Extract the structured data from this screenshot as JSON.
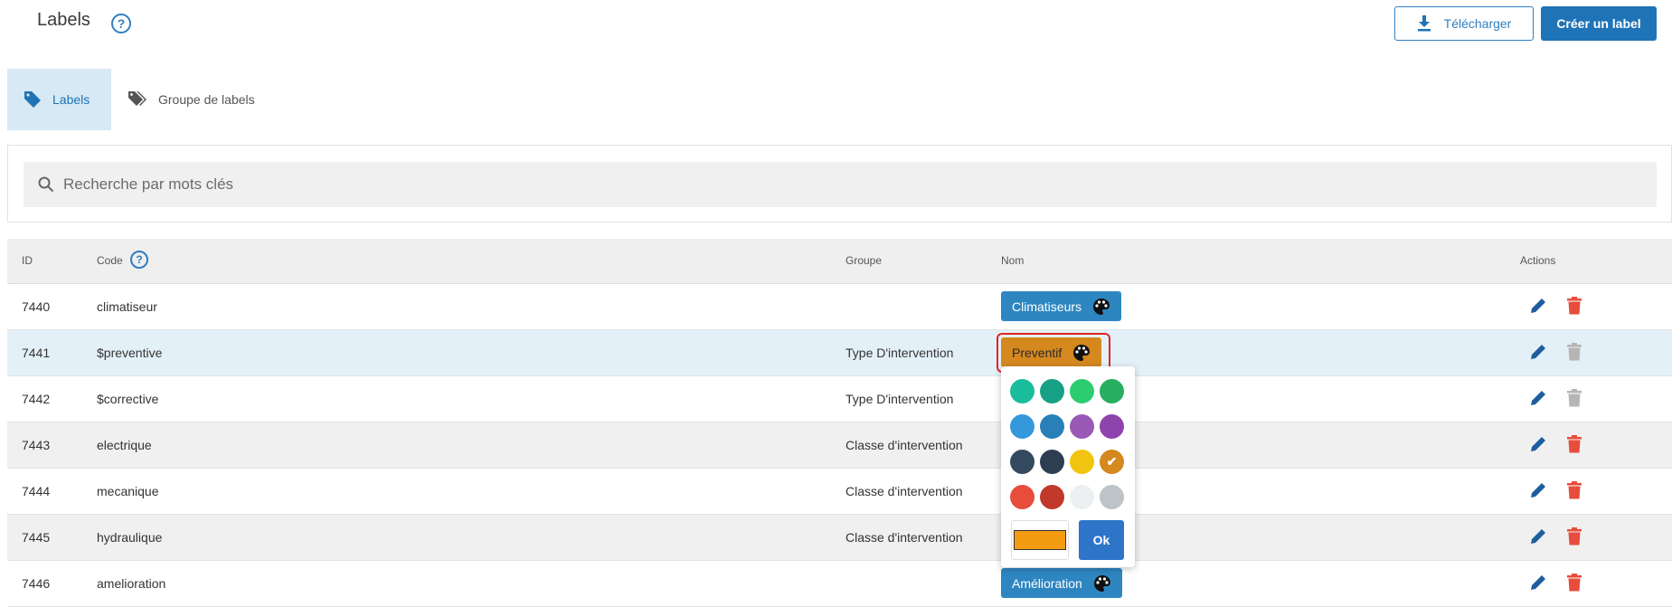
{
  "header": {
    "title": "Labels",
    "help_glyph": "?",
    "download_label": "Télécharger",
    "create_label": "Créer un label"
  },
  "tabs": [
    {
      "label": "Labels",
      "active": true,
      "icon": "tag-icon"
    },
    {
      "label": "Groupe de labels",
      "active": false,
      "icon": "tags-icon"
    }
  ],
  "search": {
    "placeholder": "Recherche par mots clés",
    "value": ""
  },
  "table": {
    "headers": {
      "id": "ID",
      "code": "Code",
      "groupe": "Groupe",
      "nom": "Nom",
      "actions": "Actions"
    },
    "rows": [
      {
        "id": "7440",
        "code": "climatiseur",
        "groupe": "",
        "nom": "Climatiseurs",
        "badge_color": "#2e86c1"
      },
      {
        "id": "7441",
        "code": "$preventive",
        "groupe": "Type D'intervention",
        "nom": "Preventif",
        "badge_color": "#d4881e"
      },
      {
        "id": "7442",
        "code": "$corrective",
        "groupe": "Type D'intervention",
        "nom": "",
        "badge_color": ""
      },
      {
        "id": "7443",
        "code": "electrique",
        "groupe": "Classe d'intervention",
        "nom": "",
        "badge_color": ""
      },
      {
        "id": "7444",
        "code": "mecanique",
        "groupe": "Classe d'intervention",
        "nom": "",
        "badge_color": ""
      },
      {
        "id": "7445",
        "code": "hydraulique",
        "groupe": "Classe d'intervention",
        "nom": "",
        "badge_color": ""
      },
      {
        "id": "7446",
        "code": "amelioration",
        "groupe": "",
        "nom": "Amélioration",
        "badge_color": "#2e86c1"
      }
    ]
  },
  "color_picker": {
    "swatches": [
      "#1abc9c",
      "#16a085",
      "#2ecc71",
      "#27ae60",
      "#3498db",
      "#2980b9",
      "#9b59b6",
      "#8e44ad",
      "#34495e",
      "#2c3e50",
      "#f1c40f",
      "#d4881e",
      "#e74c3c",
      "#c0392b",
      "#ecf0f1",
      "#bdc3c7"
    ],
    "selected_swatch": "#d4881e",
    "custom_color": "#f39c12",
    "ok_label": "Ok"
  },
  "colors": {
    "accent": "#1f73b7",
    "delete": "#e74c3c",
    "delete_disabled": "#b5b5b5",
    "edit": "#1f5e9e"
  }
}
